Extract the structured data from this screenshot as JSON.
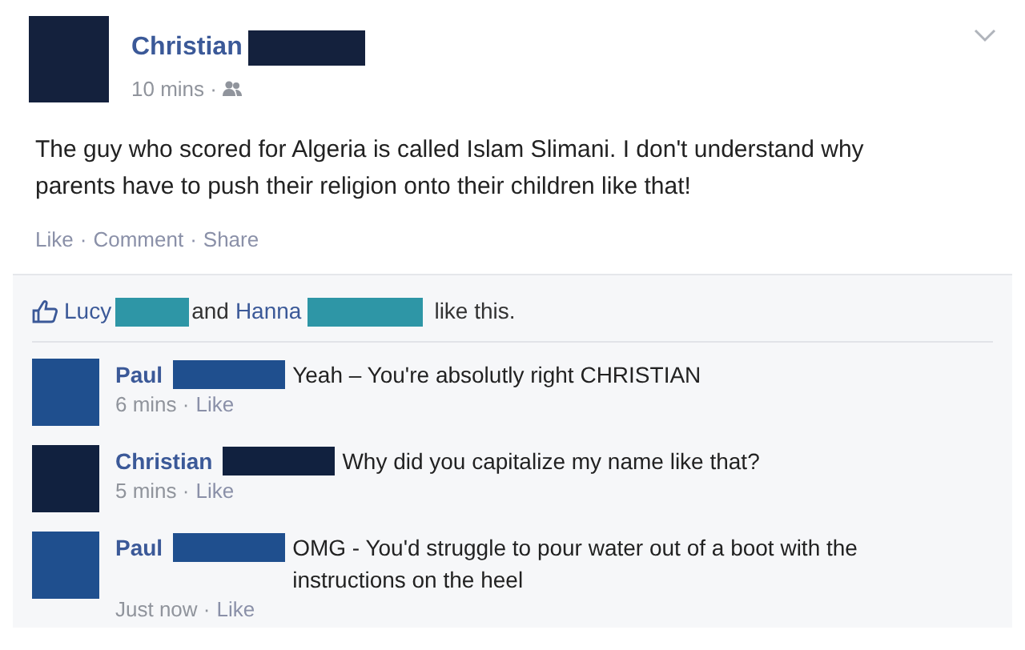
{
  "post": {
    "author": "Christian",
    "color": "#14213d",
    "meta": "10 mins ·",
    "text": "The guy who scored for Algeria is called Islam Slimani. I don't understand why parents have to push their religion onto their children like that!",
    "actions": [
      "Like",
      "Comment",
      "Share"
    ],
    "separator": "·"
  },
  "likes": {
    "people": [
      {
        "name": "Lucy",
        "color": "#2e96a6"
      },
      {
        "name": "Hanna",
        "color": "#2e96a6"
      }
    ],
    "connector": "and",
    "suffix": "like this."
  },
  "comments": [
    {
      "author": "Paul",
      "color": "#1f4f8e",
      "text": "Yeah – You're absolutly right CHRISTIAN",
      "meta": "6 mins ·",
      "action": "Like"
    },
    {
      "author": "Christian",
      "color": "#11213f",
      "text": "Why did you capitalize my name like that?",
      "meta": "5 mins ·",
      "action": "Like"
    },
    {
      "author": "Paul",
      "color": "#1f4f8e",
      "text": "OMG - You'd struggle to pour water out of a boot with the instructions on the heel",
      "meta": "Just now ·",
      "action": "Like"
    }
  ]
}
